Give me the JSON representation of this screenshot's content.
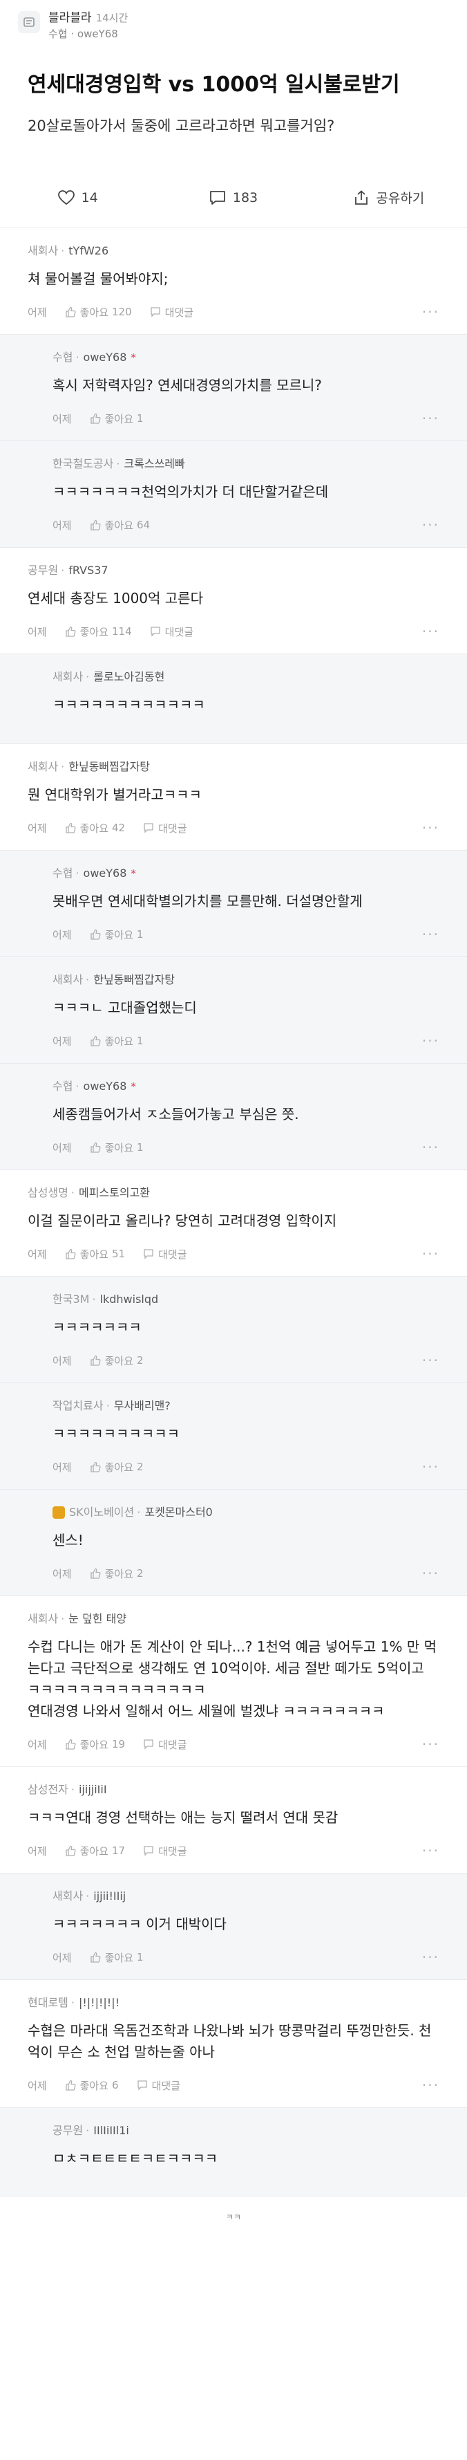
{
  "header": {
    "board_name": "블라블라",
    "time": "14시간",
    "author_line": "수협 · oweY68"
  },
  "post": {
    "title": "연세대경영입학 vs 1000억 일시불로받기",
    "body": "20살로돌아가서 둘중에 고르라고하면 뭐고를거임?",
    "likes": "14",
    "comments": "183",
    "share_label": "공유하기"
  },
  "labels": {
    "time_label": "어제",
    "like_prefix": "좋아요",
    "reply_label": "대댓글",
    "more": "···",
    "op_mark": "*"
  },
  "comments": [
    {
      "company": "새회사",
      "nick": "tYfW26",
      "reply": false,
      "text": "쳐 물어볼걸 물어봐야지;",
      "likes": "120",
      "has_reply_btn": true
    },
    {
      "company": "수협",
      "nick": "oweY68",
      "reply": true,
      "op": true,
      "text": "혹시 저학력자임? 연세대경영의가치를 모르니?",
      "likes": "1"
    },
    {
      "company": "한국철도공사",
      "nick": "크록스쓰레빠",
      "reply": true,
      "text": "ㅋㅋㅋㅋㅋㅋㅋ천억의가치가 더 대단할거같은데",
      "likes": "64"
    },
    {
      "company": "공무원",
      "nick": "fRVS37",
      "reply": false,
      "text": "연세대 총장도 1000억 고른다",
      "likes": "114",
      "has_reply_btn": true
    },
    {
      "company": "새회사",
      "nick": "롤로노아김동현",
      "reply": true,
      "text": "ㅋㅋㅋㅋㅋㅋㅋㅋㅋㅋㅋㅋ",
      "likes": "",
      "no_foot": true
    },
    {
      "company": "새회사",
      "nick": "한닢동뻐찜갑자탕",
      "reply": false,
      "text": "뭔 연대학위가 별거라고ㅋㅋㅋ",
      "likes": "42",
      "has_reply_btn": true
    },
    {
      "company": "수협",
      "nick": "oweY68",
      "reply": true,
      "op": true,
      "text": "못배우면 연세대학별의가치를 모를만해. 더설명안할게",
      "likes": "1"
    },
    {
      "company": "새회사",
      "nick": "한닢동뻐찜갑자탕",
      "reply": true,
      "text": "ㅋㅋㅋㄴ 고대졸업했는디",
      "likes": "1"
    },
    {
      "company": "수협",
      "nick": "oweY68",
      "reply": true,
      "op": true,
      "text": "세종캠들어가서 ㅈ소들어가놓고 부심은 쯧.",
      "likes": "1"
    },
    {
      "company": "삼성생명",
      "nick": "메피스토의고환",
      "reply": false,
      "text": "이걸 질문이라고 올리나? 당연히 고려대경영 입학이지",
      "likes": "51",
      "has_reply_btn": true
    },
    {
      "company": "한국3M",
      "nick": "lkdhwislqd",
      "reply": true,
      "text": "ㅋㅋㅋㅋㅋㅋㅋ",
      "likes": "2"
    },
    {
      "company": "작업치료사",
      "nick": "무사배리맨?",
      "reply": true,
      "text": "ㅋㅋㅋㅋㅋㅋㅋㅋㅋㅋ",
      "likes": "2"
    },
    {
      "company": "SK이노베이션",
      "nick": "포켓몬마스터0",
      "reply": true,
      "badge": true,
      "text": "센스!",
      "likes": "2"
    },
    {
      "company": "새회사",
      "nick": "눈 덮힌 태양",
      "reply": false,
      "text": "수컵 다니는 애가 돈 계산이 안 되나...? 1천억 예금 넣어두고 1% 만 먹는다고 극단적으로 생각해도 연 10억이야. 세금 절반 떼가도 5억이고 ㅋㅋㅋㅋㅋㅋㅋㅋㅋㅋㅋㅋㅋㅋ\n연대경영 나와서 일해서 어느 세월에 벌겠냐 ㅋㅋㅋㅋㅋㅋㅋㅋ",
      "likes": "19",
      "has_reply_btn": true
    },
    {
      "company": "삼성전자",
      "nick": "ijijjiIiI",
      "reply": false,
      "text": "ㅋㅋㅋ연대 경영 선택하는 애는 능지 떨려서 연대 못감",
      "likes": "17",
      "has_reply_btn": true
    },
    {
      "company": "새회사",
      "nick": "ijjii!IIij",
      "reply": true,
      "text": "ㅋㅋㅋㅋㅋㅋㅋ 이거 대박이다",
      "likes": "1"
    },
    {
      "company": "현대로템",
      "nick": "|!|!|!|!|!",
      "reply": false,
      "text": "수협은 마라대 옥돔건조학과 나왔나봐 뇌가 땅콩막걸리 뚜껑만한듯. 천억이 무슨 소 천업 말하는줄 아나",
      "likes": "6",
      "has_reply_btn": true
    },
    {
      "company": "공무원",
      "nick": "IIlIiIIl1i",
      "reply": true,
      "text": "ㅁㅊㅋㅌㅌㅌㅌㅋㅌㅋㅋㅋㅋ",
      "likes": "",
      "no_foot": true,
      "last": true
    }
  ],
  "bottom_note": "ㅋㅋ"
}
